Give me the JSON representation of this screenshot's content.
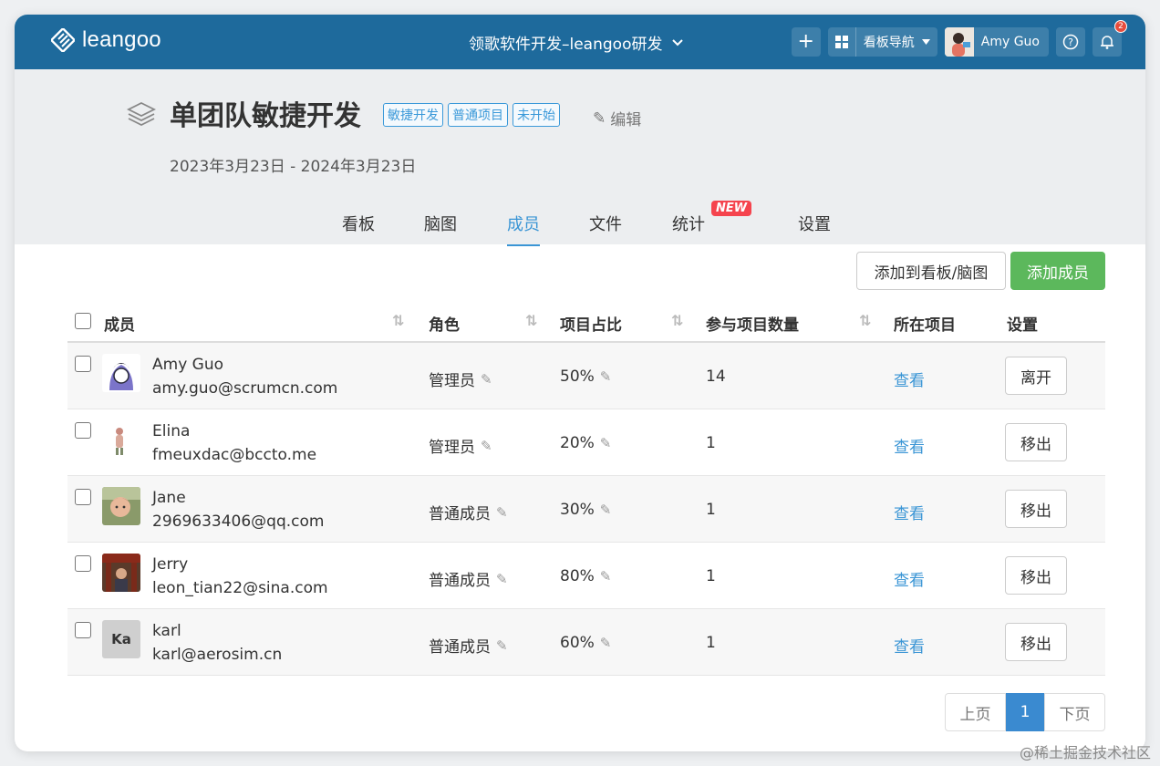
{
  "topbar": {
    "logo_text": "leangoo",
    "project_name": "领歌软件开发–leangoo研发",
    "plus_label": "+",
    "board_nav_label": "看板导航",
    "user_name": "Amy Guo",
    "notification_count": "2"
  },
  "board": {
    "title": "单团队敏捷开发",
    "tags": [
      "敏捷开发",
      "普通项目",
      "未开始"
    ],
    "edit_label": "编辑",
    "date_range": "2023年3月23日 - 2024年3月23日"
  },
  "tabs": [
    {
      "label": "看板"
    },
    {
      "label": "脑图"
    },
    {
      "label": "成员"
    },
    {
      "label": "文件"
    },
    {
      "label": "统计"
    },
    {
      "label": "设置"
    }
  ],
  "new_badge": "NEW",
  "actions": {
    "add_to_board": "添加到看板/脑图",
    "add_member": "添加成员"
  },
  "table": {
    "headers": {
      "member": "成员",
      "role": "角色",
      "ratio": "项目占比",
      "count": "参与项目数量",
      "project": "所在项目",
      "settings": "设置"
    },
    "rows": [
      {
        "name": "Amy Guo",
        "email": "amy.guo@scrumcn.com",
        "role": "管理员",
        "ratio": "50%",
        "count": "14",
        "link": "查看",
        "action": "离开"
      },
      {
        "name": "Elina",
        "email": "fmeuxdac@bccto.me",
        "role": "管理员",
        "ratio": "20%",
        "count": "1",
        "link": "查看",
        "action": "移出"
      },
      {
        "name": "Jane",
        "email": "2969633406@qq.com",
        "role": "普通成员",
        "ratio": "30%",
        "count": "1",
        "link": "查看",
        "action": "移出"
      },
      {
        "name": "Jerry",
        "email": "leon_tian22@sina.com",
        "role": "普通成员",
        "ratio": "80%",
        "count": "1",
        "link": "查看",
        "action": "移出"
      },
      {
        "name": "karl",
        "email": "karl@aerosim.cn",
        "role": "普通成员",
        "ratio": "60%",
        "count": "1",
        "link": "查看",
        "action": "移出",
        "avatar_text": "Ka"
      }
    ]
  },
  "pagination": {
    "prev": "上页",
    "current": "1",
    "next": "下页"
  },
  "watermark": "@稀土掘金技术社区",
  "colors": {
    "topbar": "#1e6a9c",
    "accent": "#3a95d5",
    "add_member": "#5cb85c",
    "new_badge": "#f5444e"
  }
}
